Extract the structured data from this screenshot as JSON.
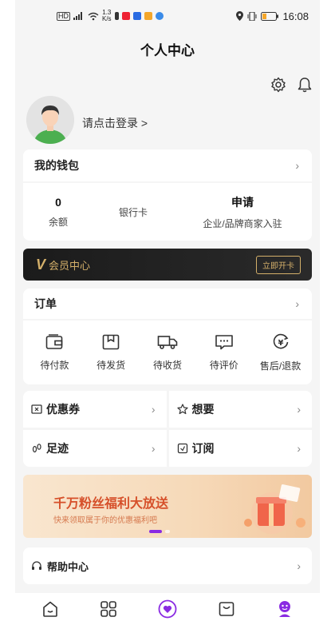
{
  "status_bar": {
    "speed": "1.3",
    "speed_unit": "K/s",
    "time": "16:08"
  },
  "header": {
    "title": "个人中心"
  },
  "profile": {
    "login_prompt": "请点击登录 >"
  },
  "wallet": {
    "title": "我的钱包",
    "balance_value": "0",
    "balance_label": "余额",
    "bank_card_label": "银行卡",
    "apply_value": "申请",
    "apply_label": "企业/品牌商家入驻"
  },
  "vip": {
    "logo": "V",
    "label": "会员中心",
    "button": "立即开卡"
  },
  "orders": {
    "title": "订单",
    "items": [
      {
        "label": "待付款",
        "icon": "wallet-icon"
      },
      {
        "label": "待发货",
        "icon": "package-icon"
      },
      {
        "label": "待收货",
        "icon": "truck-icon"
      },
      {
        "label": "待评价",
        "icon": "comment-icon"
      },
      {
        "label": "售后/退款",
        "icon": "refund-icon"
      }
    ]
  },
  "grid": {
    "coupons": "优惠券",
    "wishlist": "想要",
    "footprints": "足迹",
    "subscriptions": "订阅"
  },
  "banner": {
    "headline": "千万粉丝福利大放送",
    "subline": "快来领取属于你的优惠福利吧"
  },
  "help": {
    "label": "帮助中心"
  },
  "colors": {
    "accent": "#8a2be2",
    "vip_gold": "#d4b06a",
    "banner_text": "#d6502a"
  }
}
